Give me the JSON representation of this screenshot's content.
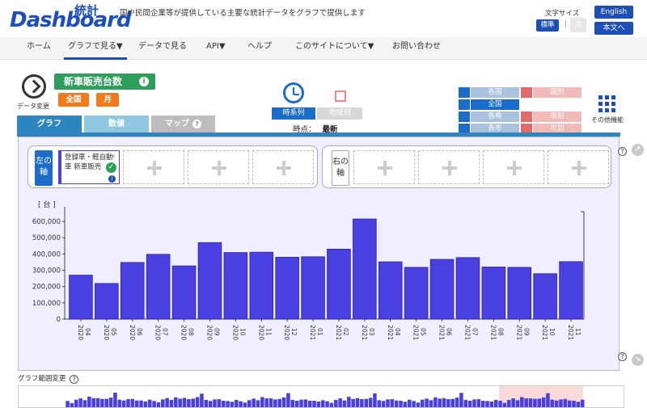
{
  "header": {
    "logo_text": "Dashboard",
    "logo_sub": "統計",
    "tagline": "国や民間企業等が提供している主要な統計データをグラフで提供します",
    "font_size_label": "文字サイズ",
    "font_std": "標準",
    "font_sep": "|",
    "font_big": "大",
    "english": "English",
    "skip": "本文へ"
  },
  "nav": [
    "ホーム",
    "グラフで見る▼",
    "データで見る",
    "API▼",
    "ヘルプ",
    "このサイトについて▼",
    "お問い合わせ"
  ],
  "title": {
    "data_change": "データ変更",
    "name": "新車販売台数",
    "info_icon": "i",
    "tag_region": "全国",
    "tag_period": "月"
  },
  "mode": {
    "timeseries": "時系列",
    "by_region": "地域別",
    "timepoint_label": "時点：",
    "timepoint_value": "最新"
  },
  "area": {
    "by_country": "各国",
    "international": "国別",
    "national": "全国",
    "by_prefecture": "各県",
    "prefecture": "県別",
    "by_city": "各市",
    "city": "市別"
  },
  "other_functions": "その他機能",
  "tabs": {
    "graph": "グラフ",
    "values": "数値",
    "map": "マップ",
    "help": "?"
  },
  "axes": {
    "left": "左の軸",
    "right": "右の軸",
    "series_label": "登録車・軽自動車 新車販売",
    "series_close": "✕",
    "check": "✓",
    "info": "i"
  },
  "range_label": "グラフ範囲変更",
  "colors": {
    "bar": "#4a3fe0",
    "primary": "#1c6cc9",
    "green": "#2ca05a",
    "orange": "#f07a1c"
  },
  "chart_data": {
    "type": "bar",
    "ylabel": "[ 台 ]",
    "ylim": [
      0,
      650000
    ],
    "yticks": [
      0,
      100000,
      200000,
      300000,
      400000,
      500000,
      600000
    ],
    "ytick_labels": [
      "0",
      "100,000",
      "200,000",
      "300,000",
      "400,000",
      "500,000",
      "600,000"
    ],
    "categories": [
      [
        "2020",
        "04"
      ],
      [
        "2020",
        "05"
      ],
      [
        "2020",
        "06"
      ],
      [
        "2020",
        "07"
      ],
      [
        "2020",
        "08"
      ],
      [
        "2020",
        "09"
      ],
      [
        "2020",
        "10"
      ],
      [
        "2020",
        "11"
      ],
      [
        "2020",
        "12"
      ],
      [
        "2021",
        "01"
      ],
      [
        "2021",
        "02"
      ],
      [
        "2021",
        "03"
      ],
      [
        "2021",
        "04"
      ],
      [
        "2021",
        "05"
      ],
      [
        "2021",
        "06"
      ],
      [
        "2021",
        "07"
      ],
      [
        "2021",
        "08"
      ],
      [
        "2021",
        "09"
      ],
      [
        "2021",
        "10"
      ],
      [
        "2021",
        "11"
      ]
    ],
    "values": [
      270000,
      219000,
      348000,
      398000,
      327000,
      470000,
      409000,
      411000,
      380000,
      383000,
      430000,
      615000,
      352000,
      318000,
      367000,
      378000,
      320000,
      318000,
      279000,
      353000
    ]
  },
  "range_overview": [
    30,
    22,
    35,
    40,
    33,
    47,
    41,
    41,
    38,
    38,
    43,
    62,
    35,
    32,
    37,
    38,
    32,
    32,
    28,
    35,
    30,
    25,
    36,
    41,
    34,
    44,
    39,
    42,
    37,
    39,
    45,
    58,
    34,
    30,
    36,
    37,
    31,
    30,
    27,
    34,
    29,
    24,
    33,
    39,
    33,
    45,
    40,
    40,
    36,
    38,
    44,
    60,
    34,
    31,
    35,
    36,
    31,
    31,
    28,
    33,
    29,
    23,
    34,
    40,
    32,
    46,
    38,
    41,
    37,
    38,
    42,
    59,
    33,
    30,
    36,
    37,
    32,
    31,
    27,
    35,
    30,
    24,
    35,
    39,
    33,
    44,
    39,
    41,
    37,
    38,
    43,
    61,
    34,
    31,
    36,
    37,
    31,
    30,
    28,
    34,
    31,
    23,
    34,
    40,
    33,
    45,
    40,
    40,
    38,
    39,
    44,
    60,
    35,
    32,
    36,
    38,
    32,
    31,
    27,
    35
  ]
}
